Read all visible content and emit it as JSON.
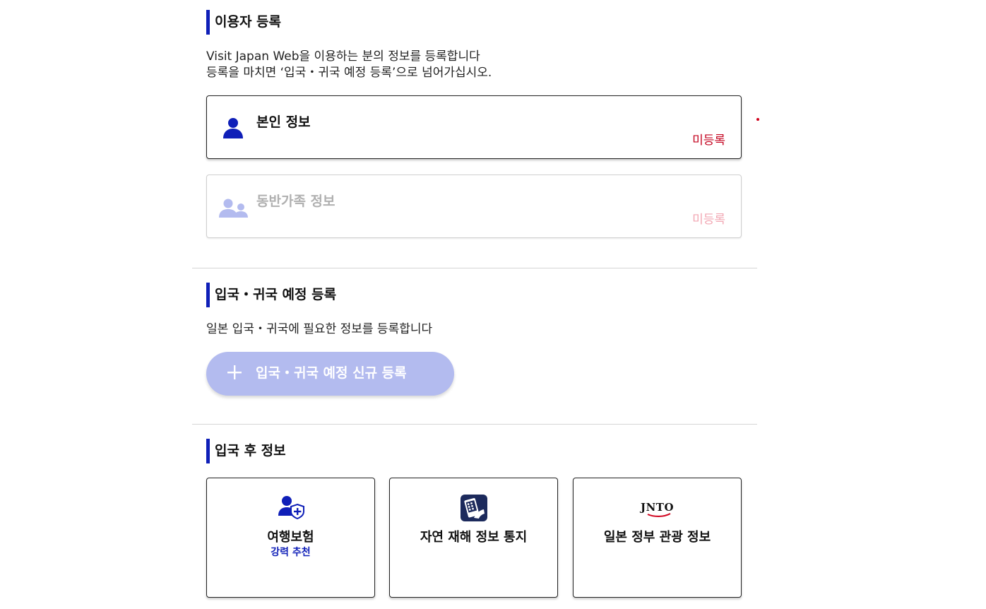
{
  "user_registration": {
    "title": "이용자 등록",
    "desc_line1": "Visit Japan Web을 이용하는 분의 정보를 등록합니다",
    "desc_line2": "등록을 마치면 ‘입국・귀국 예정 등록’으로 넘어가십시오.",
    "cards": [
      {
        "title": "본인 정보",
        "status": "미등록",
        "icon": "person-icon"
      },
      {
        "title": "동반가족 정보",
        "status": "미등록",
        "icon": "family-icon"
      }
    ]
  },
  "entry_plan": {
    "title": "입국・귀국 예정 등록",
    "desc": "일본 입국・귀국에 필요한 정보를 등록합니다",
    "add_button_label": "입국・귀국 예정 신규 등록"
  },
  "after_entry": {
    "title": "입국 후 정보",
    "tiles": [
      {
        "title": "여행보험",
        "subtitle": "강력 추천",
        "icon": "insurance-shield-icon"
      },
      {
        "title": "자연 재해 정보 통지",
        "icon": "disaster-info-icon"
      },
      {
        "title": "일본 정부 관광 정보",
        "icon": "jnto-logo",
        "logo_text": "JNTO"
      }
    ]
  },
  "colors": {
    "accent": "#0f1fb8",
    "status_unregistered": "#c3001d",
    "button_disabled": "#b3bbef"
  }
}
